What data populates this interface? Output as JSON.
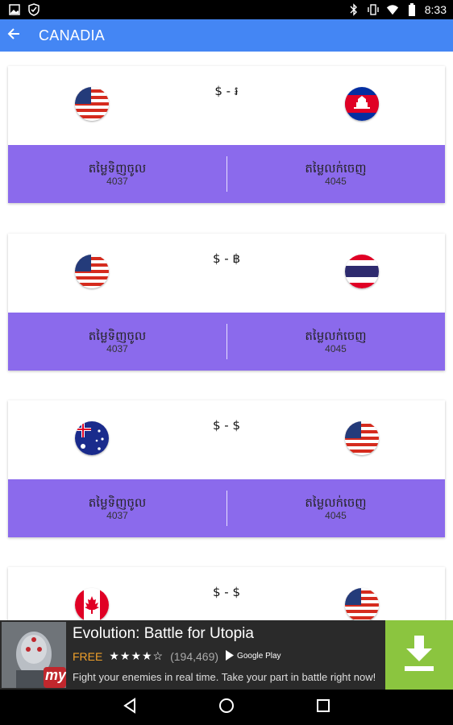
{
  "status_bar": {
    "time": "8:33",
    "icons_left": [
      "gallery-icon",
      "shield-icon"
    ],
    "icons_right": [
      "bluetooth-icon",
      "vibrate-icon",
      "wifi-icon",
      "battery-icon"
    ]
  },
  "app_bar": {
    "title": "CANADIA",
    "back_icon": "arrow-left-icon"
  },
  "cards": [
    {
      "flag_left": "usa",
      "flag_right": "cambodia",
      "pair": "$ - ៛",
      "buy_label": "តម្លៃទិញចូល",
      "buy_value": "4037",
      "sell_label": "តម្លៃលក់ចេញ",
      "sell_value": "4045"
    },
    {
      "flag_left": "usa",
      "flag_right": "thailand",
      "pair": "$ - ฿",
      "buy_label": "តម្លៃទិញចូល",
      "buy_value": "4037",
      "sell_label": "តម្លៃលក់ចេញ",
      "sell_value": "4045"
    },
    {
      "flag_left": "australia",
      "flag_right": "usa",
      "pair": "$ - $",
      "buy_label": "តម្លៃទិញចូល",
      "buy_value": "4037",
      "sell_label": "តម្លៃលក់ចេញ",
      "sell_value": "4045"
    },
    {
      "flag_left": "canada",
      "flag_right": "usa",
      "pair": "$ - $"
    }
  ],
  "ad": {
    "title": "Evolution: Battle for Utopia",
    "price": "FREE",
    "stars": "★★★★☆",
    "rating_count": "(194,469)",
    "store": "Google Play",
    "description": "Fight your enemies in real time. Take your part in battle right now!",
    "badge": "my",
    "download_icon": "download-icon"
  },
  "nav_bar": {
    "buttons": [
      "back-triangle-icon",
      "home-circle-icon",
      "recents-square-icon"
    ]
  },
  "colors": {
    "app_bar": "#4486f4",
    "card_bottom": "#8b6aec",
    "ad_download": "#8bc53f",
    "ad_free": "#f0a02a"
  }
}
